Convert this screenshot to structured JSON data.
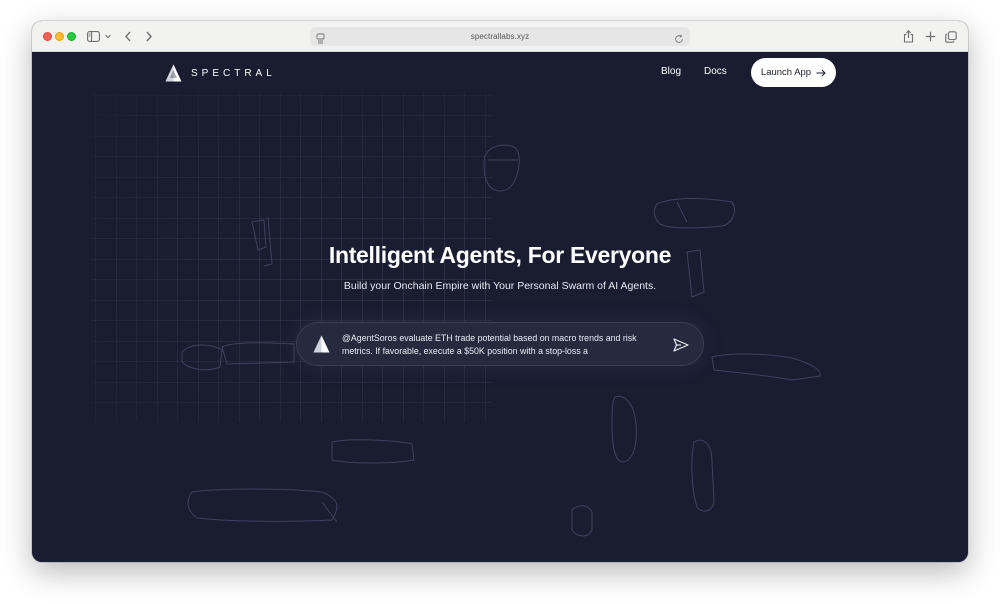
{
  "browser": {
    "url": "spectrallabs.xyz",
    "icons": [
      "sidebar-icon",
      "chevron-down-icon",
      "back-icon",
      "forward-icon",
      "page-icon",
      "reload-icon",
      "share-icon",
      "new-tab-icon",
      "tabs-overview-icon"
    ]
  },
  "nav": {
    "logo_text": "SPECTRAL",
    "links": [
      "Blog",
      "Docs"
    ],
    "launch_label": "Launch App"
  },
  "hero": {
    "title": "Intelligent Agents, For Everyone",
    "subtitle": "Build your Onchain Empire with Your Personal Swarm of AI Agents."
  },
  "prompt": {
    "text": "@AgentSoros evaluate ETH trade potential based on macro trends and risk metrics. If favorable, execute a $50K position with a stop-loss a"
  },
  "colors": {
    "page_background": "#1a1d30",
    "button_background": "#ffffff",
    "text": "#ffffff"
  }
}
